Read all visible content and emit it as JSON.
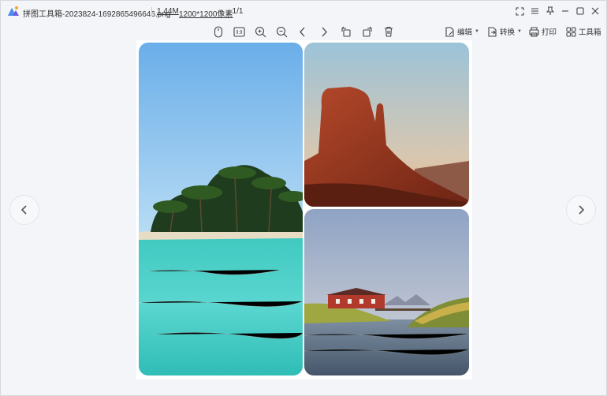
{
  "titlebar": {
    "file_name": "拼图工具箱-2023824-1692865496646.png",
    "file_size": "1.44M",
    "file_dims": "1200*1200像素",
    "page_indicator": ", 1/1"
  },
  "toolbar": {
    "tools": [
      "mouse-icon",
      "actual-size-icon",
      "zoom-in-icon",
      "zoom-out-icon",
      "previous-icon",
      "next-icon",
      "rotate-left-icon",
      "rotate-right-icon",
      "delete-icon"
    ],
    "edit_label": "编辑",
    "convert_label": "转换",
    "print_label": "打印",
    "toolbox_label": "工具箱"
  },
  "window_controls": [
    "fullscreen-icon",
    "menu-icon",
    "pin-icon",
    "minimize-icon",
    "maximize-icon",
    "close-icon"
  ],
  "collage": {
    "images": [
      "tropical island with palm trees and turquoise water",
      "red sandstone butte in desert",
      "red house by lake with mountains"
    ]
  },
  "colors": {
    "accent": "#5b6ad9",
    "icon": "#555555"
  }
}
